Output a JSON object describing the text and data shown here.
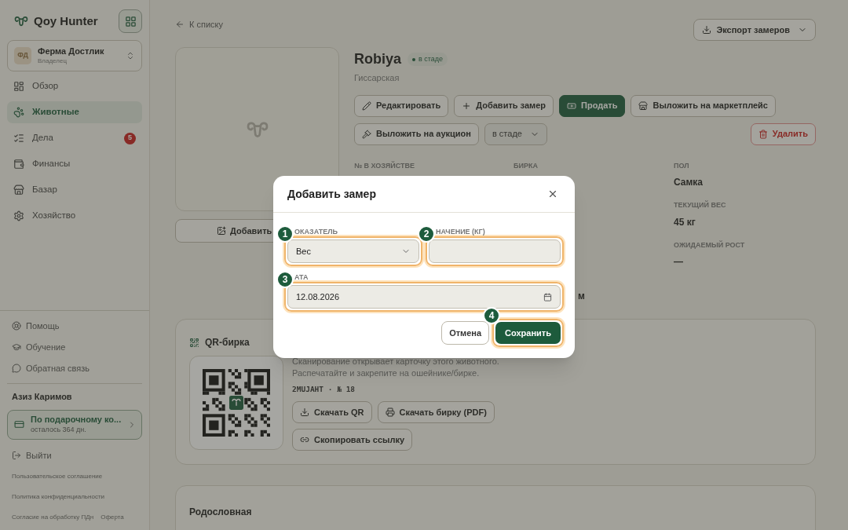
{
  "sidebar": {
    "brand": "Qoy Hunter",
    "farm": {
      "initials": "ФД",
      "name": "Ферма Достлик",
      "role": "Владелец"
    },
    "nav": [
      {
        "label": "Обзор",
        "selected": false
      },
      {
        "label": "Животные",
        "selected": true
      },
      {
        "label": "Дела",
        "selected": false,
        "badge": "5"
      },
      {
        "label": "Финансы",
        "selected": false
      },
      {
        "label": "Базар",
        "selected": false
      },
      {
        "label": "Хозяйство",
        "selected": false
      }
    ],
    "help_links": [
      "Помощь",
      "Обучение",
      "Обратная связь"
    ],
    "user_name": "Азиз Каримов",
    "plan": {
      "title": "По подарочному ко...",
      "subtitle": "осталось 364 дн."
    },
    "logout": "Выйти",
    "legal": [
      "Пользовательское соглашение",
      "Политика конфиденциальности",
      "Согласие на обработку ПДн",
      "Оферта"
    ]
  },
  "main": {
    "back_link": "К списку",
    "export_button": "Экспорт замеров",
    "photo_button": "Добавить",
    "animal": {
      "name": "Robiya",
      "status": "в стаде",
      "breed": "Гиссарская"
    },
    "actions": [
      {
        "label": "Редактировать",
        "kind": "outline"
      },
      {
        "label": "Добавить замер",
        "kind": "outline"
      },
      {
        "label": "Продать",
        "kind": "primary"
      },
      {
        "label": "Выложить на маркетплейс",
        "kind": "outline"
      },
      {
        "label": "Выложить на аукцион",
        "kind": "outline"
      },
      {
        "label": "в стаде",
        "kind": "select"
      },
      {
        "label": "Удалить",
        "kind": "danger"
      }
    ],
    "fields": [
      {
        "label": "№ В ХОЗЯЙСТВЕ"
      },
      {
        "label": "БИРКА"
      },
      {
        "label": "ПОЛ",
        "value": "Самка"
      },
      {
        "label": "ТЕКУЩИЙ ВЕС",
        "value": "45 кг"
      },
      {
        "label": "ОЖИДАЕМЫЙ РОСТ",
        "value": "—"
      }
    ],
    "hidden_fragment": "м",
    "qr": {
      "title": "QR-бирка",
      "text": "Сканирование открывает карточку этого животного.\nРаспечатайте и закрепите на ошейнике/бирке.",
      "code": "2MUJAHT · № 18",
      "buttons": [
        "Скачать QR",
        "Скачать бирку (PDF)",
        "Скопировать ссылку"
      ]
    },
    "pedigree": {
      "title": "Родословная"
    }
  },
  "modal": {
    "title": "Добавить замер",
    "metric": {
      "label": "ОКАЗАТЕЛЬ",
      "value": "Вес",
      "step": "1"
    },
    "amount": {
      "label": "НАЧЕНИЕ (КГ)",
      "step": "2"
    },
    "date": {
      "label": "АТА",
      "value": "12.08.2026",
      "step": "3"
    },
    "cancel": "Отмена",
    "save": "Сохранить",
    "save_step": "4"
  }
}
